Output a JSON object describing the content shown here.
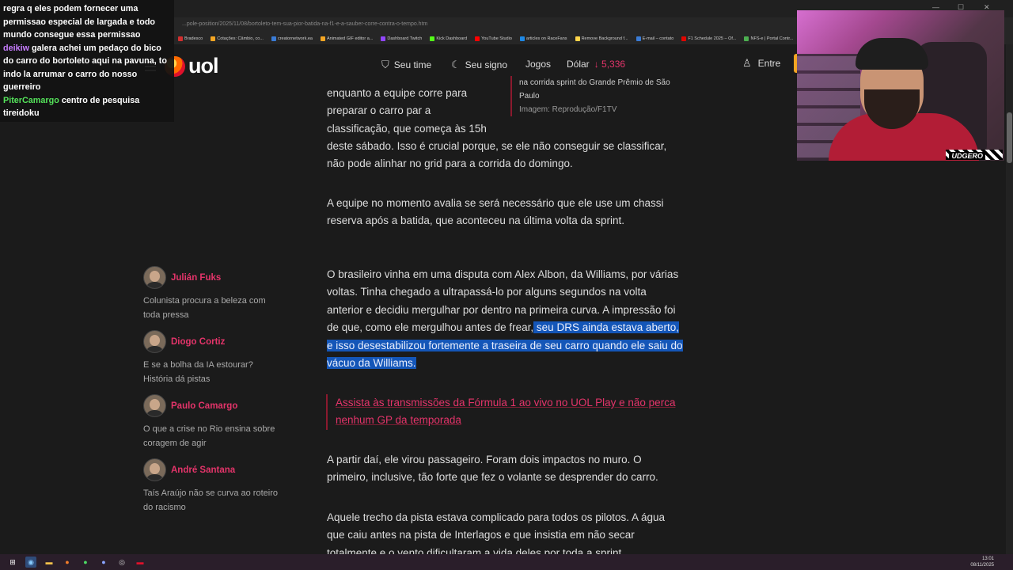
{
  "browser": {
    "url": "...pole-position/2025/11/08/bortoleto-tem-sua-pior-batida-na-f1-e-a-sauber-corre-contra-o-tempo.htm",
    "bookmarks": [
      "Bradesco",
      "Cotações: Câmbio, co...",
      "creatornetwork.ea",
      "Animated GIF editor a...",
      "Dashboard Twitch",
      "Kick Dashboard",
      "YouTube Studio",
      "articles on RaceFans",
      "Remove Background f...",
      "E-mail – contato",
      "F1 Schedule 2025 – Of...",
      "NFS-e | Portal Contr..."
    ]
  },
  "header": {
    "logo": "uol",
    "nav": {
      "seu_time": "Seu time",
      "seu_signo": "Seu signo",
      "jogos": "Jogos",
      "dolar_label": "Dólar",
      "dolar_value": "↓ 5,336",
      "entrar": "Entre"
    }
  },
  "sidebar": {
    "columnists": [
      {
        "name": "Julián Fuks",
        "desc": "Colunista procura a beleza com toda pressa"
      },
      {
        "name": "Diogo Cortiz",
        "desc": "E se a bolha da IA estourar? História dá pistas"
      },
      {
        "name": "Paulo Camargo",
        "desc": "O que a crise no Rio ensina sobre coragem de agir"
      },
      {
        "name": "André Santana",
        "desc": "Taís Araújo não se curva ao roteiro do racismo"
      }
    ]
  },
  "caption": {
    "text": "na corrida sprint do Grande Prêmio de São Paulo",
    "credit": "Imagem: Reprodução/F1TV"
  },
  "article": {
    "p1_lines": [
      "enquanto a equipe corre para",
      "preparar o carro par a",
      "classificação, que começa às 15h"
    ],
    "p1_rest": "deste sábado. Isso é crucial porque, se ele não conseguir se classificar, não pode alinhar no grid para a corrida do domingo.",
    "p2": "A equipe no momento avalia se será necessário que ele use um chassi reserva após a batida, que aconteceu na última volta da sprint.",
    "p3_plain": "O brasileiro vinha em uma disputa com Alex Albon, da Williams, por várias voltas. Tinha chegado a ultrapassá-lo por alguns segundos na volta anterior e decidiu mergulhar por dentro na primeira curva. A impressão foi de que, como ele mergulhou antes de frear,",
    "p3_highlight": " seu DRS ainda estava aberto, e isso desestabilizou fortemente a traseira de seu carro quando ele saiu do vácuo da Williams.",
    "promo": "Assista às transmissões da Fórmula 1 ao vivo no UOL Play e não perca nenhum GP da temporada",
    "p4": "A partir daí, ele virou passageiro. Foram dois impactos no muro. O primeiro, inclusive, tão forte que fez o volante se desprender do carro.",
    "p5": "Aquele trecho da pista estava complicado para todos os pilotos. A água que caiu antes na pista de Interlagos e que insistia em não secar totalmente e o vento dificultaram a vida deles por toda a sprint."
  },
  "chat": {
    "messages": [
      {
        "user": "",
        "color": "#ffffff",
        "text": "regra q eles podem fornecer uma permissao especial de largada e todo mundo consegue essa permissao"
      },
      {
        "user": "deikiw",
        "color": "#c77dff",
        "text": "galera achei um pedaço do bico do carro do bortoleto aqui na pavuna, to indo la arrumar o carro do nosso guerreiro"
      },
      {
        "user": "PiterCamargo",
        "color": "#54e35a",
        "text": "centro de pesquisa tireidoku"
      }
    ]
  },
  "webcam": {
    "tag": "UDGERO"
  },
  "taskbar": {
    "time": "13:01",
    "date": "08/11/2025"
  }
}
